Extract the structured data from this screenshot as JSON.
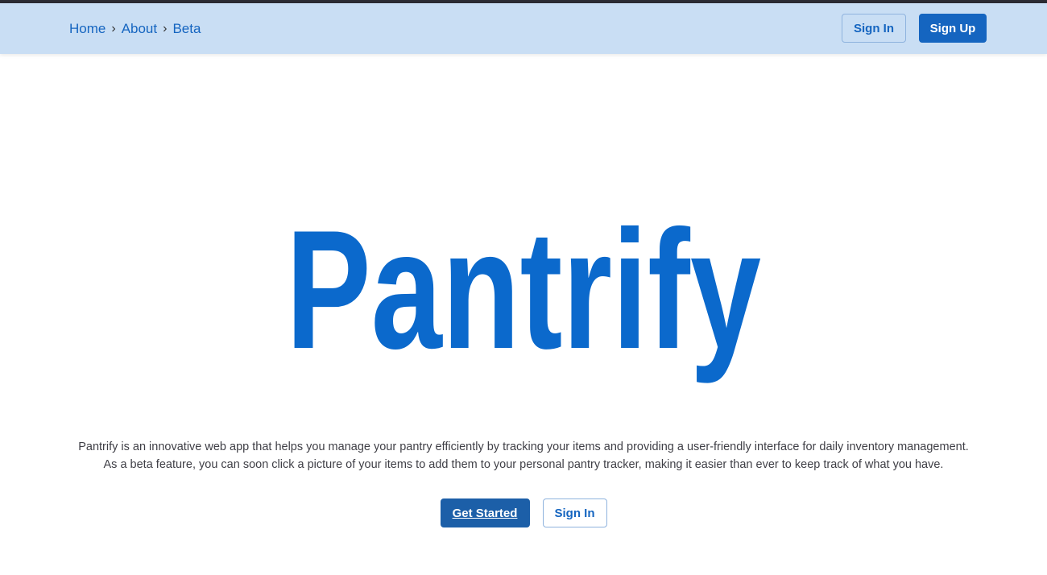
{
  "colors": {
    "navbar_bg": "#c9def4",
    "brand_blue": "#1565c0",
    "logo_blue": "#0b69cc",
    "primary_button": "#1c5fa8"
  },
  "breadcrumb": {
    "items": [
      "Home",
      "About",
      "Beta"
    ],
    "separator": "›"
  },
  "nav": {
    "sign_in_label": "Sign In",
    "sign_up_label": "Sign Up"
  },
  "hero": {
    "logo_text": "Pantrify"
  },
  "description": {
    "line1": "Pantrify is an innovative web app that helps you manage your pantry efficiently by tracking your items and providing a user-friendly interface for daily inventory management.",
    "line2": "As a beta feature, you can soon click a picture of your items to add them to your personal pantry tracker, making it easier than ever to keep track of what you have."
  },
  "cta": {
    "get_started_label": "Get Started",
    "sign_in_label": "Sign In"
  }
}
